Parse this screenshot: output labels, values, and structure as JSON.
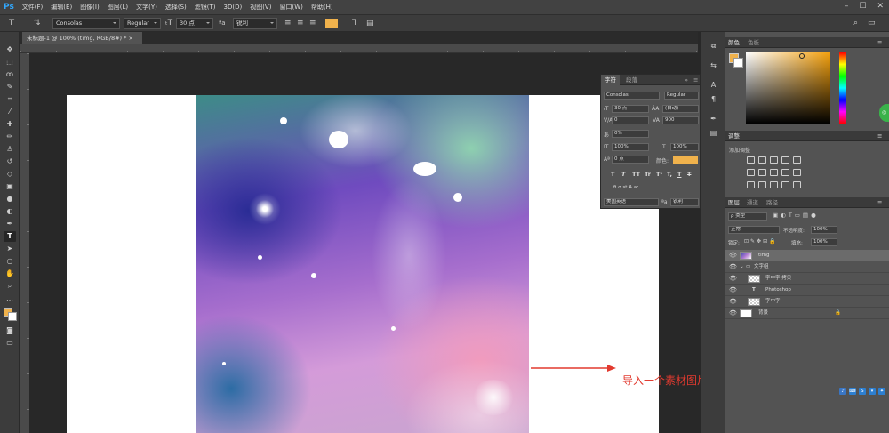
{
  "menubar": {
    "logo": "Ps",
    "items": [
      "文件(F)",
      "编辑(E)",
      "图像(I)",
      "图层(L)",
      "文字(Y)",
      "选择(S)",
      "滤镜(T)",
      "3D(D)",
      "视图(V)",
      "窗口(W)",
      "帮助(H)"
    ]
  },
  "options": {
    "font_family": "Consolas",
    "font_style": "Regular",
    "font_size": "30 点",
    "antialias": "锐利",
    "text_color": "#f0b24c"
  },
  "document": {
    "tab_title": "未标题-1 @ 100% (timg, RGB/8#) *"
  },
  "annotation": {
    "text": "导入一个素材图片",
    "color": "#e23a2f"
  },
  "character_panel": {
    "tabs": [
      "字符",
      "段落"
    ],
    "font_family": "Consolas",
    "font_style": "Regular",
    "font_size": "30 点",
    "leading": "(自动)",
    "kerning": "0",
    "tracking": "900",
    "scale_pct": "0%",
    "vertical_scale": "100%",
    "horizontal_scale": "100%",
    "baseline": "0 点",
    "color_label": "颜色:",
    "type_buttons": [
      "T",
      "T",
      "TT",
      "Tr",
      "T¹",
      "T,",
      "T",
      "T"
    ],
    "language": "美国英语",
    "antialias": "锐利"
  },
  "color_panel": {
    "tabs": [
      "颜色",
      "色板"
    ],
    "foreground": "#f0b24c",
    "background": "#ffffff"
  },
  "adjust_panel": {
    "title": "调整",
    "subtitle": "添加调整"
  },
  "layers_panel": {
    "tabs": [
      "图层",
      "通道",
      "路径"
    ],
    "filter_kind": "ρ 类型",
    "blend_mode": "正常",
    "opacity_label": "不透明度:",
    "opacity": "100%",
    "lock_label": "锁定:",
    "fill_label": "填充:",
    "fill": "100%",
    "layers": [
      {
        "name": "timg",
        "selected": true
      },
      {
        "name": "文字组",
        "group": true
      },
      {
        "name": "字中字 拷贝"
      },
      {
        "name": "Photoshop",
        "text": true
      },
      {
        "name": "字中字"
      },
      {
        "name": "背景",
        "locked": true
      }
    ]
  }
}
